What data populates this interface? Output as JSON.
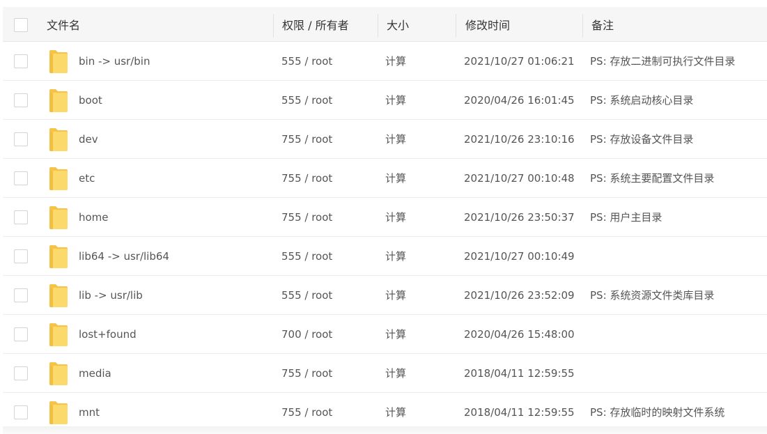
{
  "header": {
    "name": "文件名",
    "perm": "权限 / 所有者",
    "size": "大小",
    "mtime": "修改时间",
    "note": "备注"
  },
  "colors": {
    "accent": "#20a53a",
    "folder": "#f9cf5c"
  },
  "rows": [
    {
      "name": "bin -> usr/bin",
      "perm": "555 / root",
      "size": "计算",
      "mtime": "2021/10/27 01:06:21",
      "note": "PS: 存放二进制可执行文件目录"
    },
    {
      "name": "boot",
      "perm": "555 / root",
      "size": "计算",
      "mtime": "2020/04/26 16:01:45",
      "note": "PS: 系统启动核心目录"
    },
    {
      "name": "dev",
      "perm": "755 / root",
      "size": "计算",
      "mtime": "2021/10/26 23:10:16",
      "note": "PS: 存放设备文件目录"
    },
    {
      "name": "etc",
      "perm": "755 / root",
      "size": "计算",
      "mtime": "2021/10/27 00:10:48",
      "note": "PS: 系统主要配置文件目录"
    },
    {
      "name": "home",
      "perm": "755 / root",
      "size": "计算",
      "mtime": "2021/10/26 23:50:37",
      "note": "PS: 用户主目录"
    },
    {
      "name": "lib64 -> usr/lib64",
      "perm": "555 / root",
      "size": "计算",
      "mtime": "2021/10/27 00:10:49",
      "note": ""
    },
    {
      "name": "lib -> usr/lib",
      "perm": "555 / root",
      "size": "计算",
      "mtime": "2021/10/26 23:52:09",
      "note": "PS: 系统资源文件类库目录"
    },
    {
      "name": "lost+found",
      "perm": "700 / root",
      "size": "计算",
      "mtime": "2020/04/26 15:48:00",
      "note": ""
    },
    {
      "name": "media",
      "perm": "755 / root",
      "size": "计算",
      "mtime": "2018/04/11 12:59:55",
      "note": ""
    },
    {
      "name": "mnt",
      "perm": "755 / root",
      "size": "计算",
      "mtime": "2018/04/11 12:59:55",
      "note": "PS: 存放临时的映射文件系统"
    }
  ]
}
